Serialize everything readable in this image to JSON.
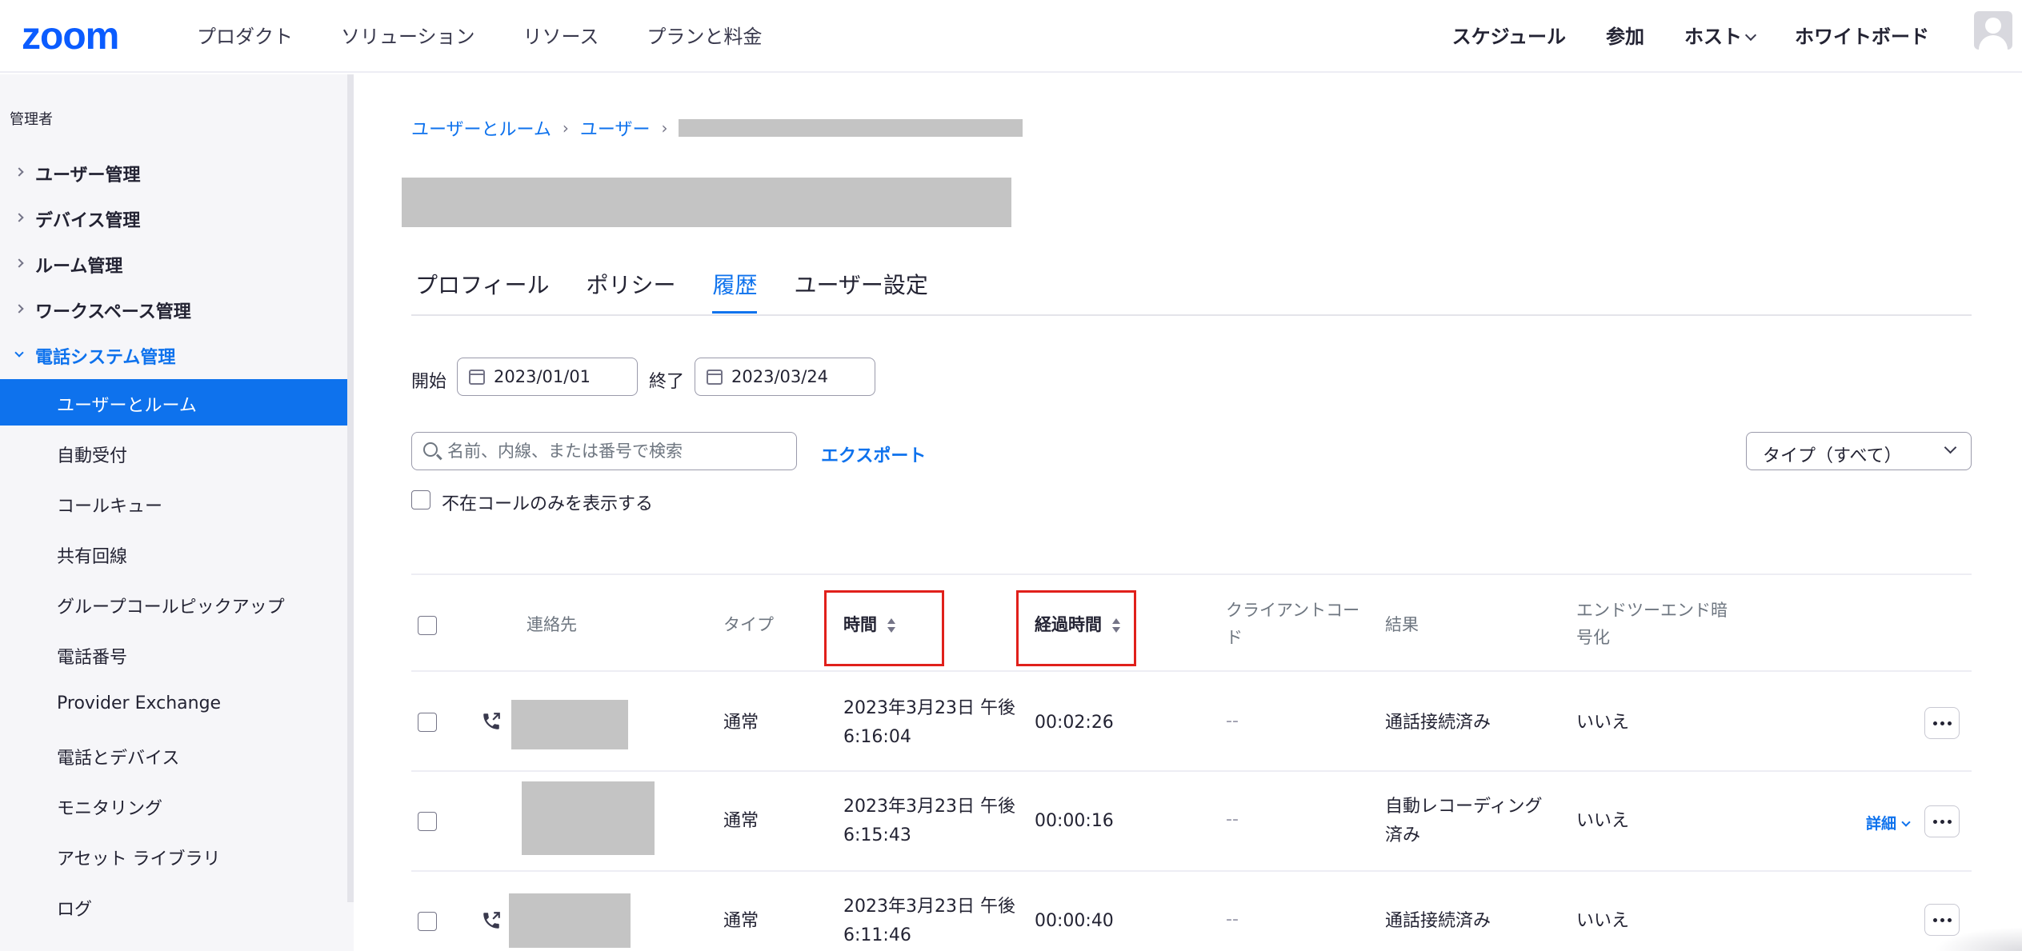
{
  "brand": {
    "logo": "zoom",
    "accent": "#0e72ed",
    "highlight": "#e0201b"
  },
  "topnav": {
    "left": [
      "プロダクト",
      "ソリューション",
      "リソース",
      "プランと料金"
    ],
    "right": [
      "スケジュール",
      "参加",
      "ホスト",
      "ホワイトボード"
    ]
  },
  "sidebar": {
    "section_label": "管理者",
    "groups": [
      "ユーザー管理",
      "デバイス管理",
      "ルーム管理",
      "ワークスペース管理",
      "電話システム管理"
    ],
    "sub_items": [
      "ユーザーとルーム",
      "自動受付",
      "コールキュー",
      "共有回線",
      "グループコールピックアップ",
      "電話番号",
      "Provider Exchange",
      "電話とデバイス",
      "モニタリング",
      "アセット ライブラリ",
      "ログ"
    ],
    "active_item": "ユーザーとルーム"
  },
  "breadcrumb": [
    "ユーザーとルーム",
    "ユーザー"
  ],
  "tabs": [
    "プロフィール",
    "ポリシー",
    "履歴",
    "ユーザー設定"
  ],
  "active_tab": "履歴",
  "filters": {
    "start_label": "開始",
    "start_date": "2023/01/01",
    "end_label": "終了",
    "end_date": "2023/03/24",
    "search_placeholder": "名前、内線、または番号で検索",
    "export_label": "エクスポート",
    "type_select": "タイプ（すべて）",
    "missed_only_label": "不在コールのみを表示する"
  },
  "table": {
    "headers": {
      "contact": "連絡先",
      "type": "タイプ",
      "time": "時間",
      "duration": "経過時間",
      "client_code_1": "クライアントコー",
      "client_code_2": "ド",
      "result": "結果",
      "e2e_1": "エンドツーエンド暗",
      "e2e_2": "号化"
    },
    "rows": [
      {
        "type": "通常",
        "time_1": "2023年3月23日 午後",
        "time_2": "6:16:04",
        "duration": "00:02:26",
        "client_code": "--",
        "result_1": "通話接続済み",
        "result_2": "",
        "e2e": "いいえ"
      },
      {
        "type": "通常",
        "time_1": "2023年3月23日 午後",
        "time_2": "6:15:43",
        "duration": "00:00:16",
        "client_code": "--",
        "result_1": "自動レコーディング",
        "result_2": "済み",
        "e2e": "いいえ"
      },
      {
        "type": "通常",
        "time_1": "2023年3月23日 午後",
        "time_2": "6:11:46",
        "duration": "00:00:40",
        "client_code": "--",
        "result_1": "通話接続済み",
        "result_2": "",
        "e2e": "いいえ"
      }
    ],
    "detail_label": "詳細"
  }
}
